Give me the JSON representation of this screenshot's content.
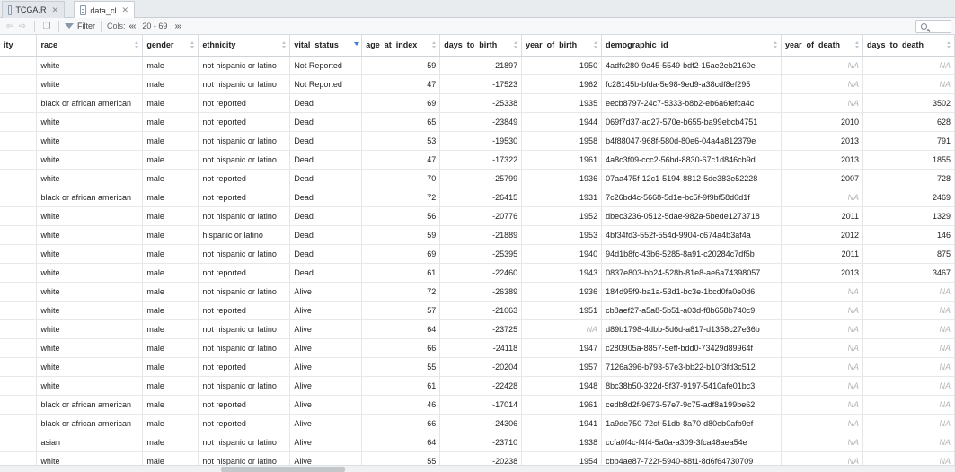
{
  "tabs": [
    {
      "label": "TCGA.R",
      "icon": "r-script-icon",
      "active": false
    },
    {
      "label": "data_cl",
      "icon": "data-table-icon",
      "active": true
    }
  ],
  "toolbar": {
    "filter_label": "Filter",
    "cols_label": "Cols:",
    "prev_cols": "«‹",
    "range": "20 - 69",
    "next_cols": "›»"
  },
  "table": {
    "columns": [
      "ity",
      "race",
      "gender",
      "ethnicity",
      "vital_status",
      "age_at_index",
      "days_to_birth",
      "year_of_birth",
      "demographic_id",
      "year_of_death",
      "days_to_death"
    ],
    "sorted_column": "vital_status",
    "rows": [
      [
        "",
        "white",
        "male",
        "not hispanic or latino",
        "Not Reported",
        "59",
        "-21897",
        "1950",
        "4adfc280-9a45-5549-bdf2-15ae2eb2160e",
        "NA",
        "NA"
      ],
      [
        "",
        "white",
        "male",
        "not hispanic or latino",
        "Not Reported",
        "47",
        "-17523",
        "1962",
        "fc28145b-bfda-5e98-9ed9-a38cdf8ef295",
        "NA",
        "NA"
      ],
      [
        "",
        "black or african american",
        "male",
        "not reported",
        "Dead",
        "69",
        "-25338",
        "1935",
        "eecb8797-24c7-5333-b8b2-eb6a6fefca4c",
        "NA",
        "3502"
      ],
      [
        "",
        "white",
        "male",
        "not reported",
        "Dead",
        "65",
        "-23849",
        "1944",
        "069f7d37-ad27-570e-b655-ba99ebcb4751",
        "2010",
        "628"
      ],
      [
        "",
        "white",
        "male",
        "not hispanic or latino",
        "Dead",
        "53",
        "-19530",
        "1958",
        "b4f88047-968f-580d-80e6-04a4a812379e",
        "2013",
        "791"
      ],
      [
        "",
        "white",
        "male",
        "not hispanic or latino",
        "Dead",
        "47",
        "-17322",
        "1961",
        "4a8c3f09-ccc2-56bd-8830-67c1d846cb9d",
        "2013",
        "1855"
      ],
      [
        "",
        "white",
        "male",
        "not reported",
        "Dead",
        "70",
        "-25799",
        "1936",
        "07aa475f-12c1-5194-8812-5de383e52228",
        "2007",
        "728"
      ],
      [
        "",
        "black or african american",
        "male",
        "not reported",
        "Dead",
        "72",
        "-26415",
        "1931",
        "7c26bd4c-5668-5d1e-bc5f-9f9bf58d0d1f",
        "NA",
        "2469"
      ],
      [
        "",
        "white",
        "male",
        "not hispanic or latino",
        "Dead",
        "56",
        "-20776",
        "1952",
        "dbec3236-0512-5dae-982a-5bede1273718",
        "2011",
        "1329"
      ],
      [
        "",
        "white",
        "male",
        "hispanic or latino",
        "Dead",
        "59",
        "-21889",
        "1953",
        "4bf34fd3-552f-554d-9904-c674a4b3af4a",
        "2012",
        "146"
      ],
      [
        "",
        "white",
        "male",
        "not hispanic or latino",
        "Dead",
        "69",
        "-25395",
        "1940",
        "94d1b8fc-43b6-5285-8a91-c20284c7df5b",
        "2011",
        "875"
      ],
      [
        "",
        "white",
        "male",
        "not reported",
        "Dead",
        "61",
        "-22460",
        "1943",
        "0837e803-bb24-528b-81e8-ae6a74398057",
        "2013",
        "3467"
      ],
      [
        "",
        "white",
        "male",
        "not hispanic or latino",
        "Alive",
        "72",
        "-26389",
        "1936",
        "184d95f9-ba1a-53d1-bc3e-1bcd0fa0e0d6",
        "NA",
        "NA"
      ],
      [
        "",
        "white",
        "male",
        "not reported",
        "Alive",
        "57",
        "-21063",
        "1951",
        "cb8aef27-a5a8-5b51-a03d-f8b658b740c9",
        "NA",
        "NA"
      ],
      [
        "",
        "white",
        "male",
        "not hispanic or latino",
        "Alive",
        "64",
        "-23725",
        "NA",
        "d89b1798-4dbb-5d6d-a817-d1358c27e36b",
        "NA",
        "NA"
      ],
      [
        "",
        "white",
        "male",
        "not hispanic or latino",
        "Alive",
        "66",
        "-24118",
        "1947",
        "c280905a-8857-5eff-bdd0-73429d89964f",
        "NA",
        "NA"
      ],
      [
        "",
        "white",
        "male",
        "not reported",
        "Alive",
        "55",
        "-20204",
        "1957",
        "7126a396-b793-57e3-bb22-b10f3fd3c512",
        "NA",
        "NA"
      ],
      [
        "",
        "white",
        "male",
        "not hispanic or latino",
        "Alive",
        "61",
        "-22428",
        "1948",
        "8bc38b50-322d-5f37-9197-5410afe01bc3",
        "NA",
        "NA"
      ],
      [
        "",
        "black or african american",
        "male",
        "not reported",
        "Alive",
        "46",
        "-17014",
        "1961",
        "cedb8d2f-9673-57e7-9c75-adf8a199be62",
        "NA",
        "NA"
      ],
      [
        "",
        "black or african american",
        "male",
        "not reported",
        "Alive",
        "66",
        "-24306",
        "1941",
        "1a9de750-72cf-51db-8a70-d80eb0afb9ef",
        "NA",
        "NA"
      ],
      [
        "",
        "asian",
        "male",
        "not hispanic or latino",
        "Alive",
        "64",
        "-23710",
        "1938",
        "ccfa0f4c-f4f4-5a0a-a309-3fca48aea54e",
        "NA",
        "NA"
      ],
      [
        "",
        "white",
        "male",
        "not hispanic or latino",
        "Alive",
        "55",
        "-20238",
        "1954",
        "cbb4ae87-722f-5940-88f1-8d6f64730709",
        "NA",
        "NA"
      ]
    ]
  }
}
